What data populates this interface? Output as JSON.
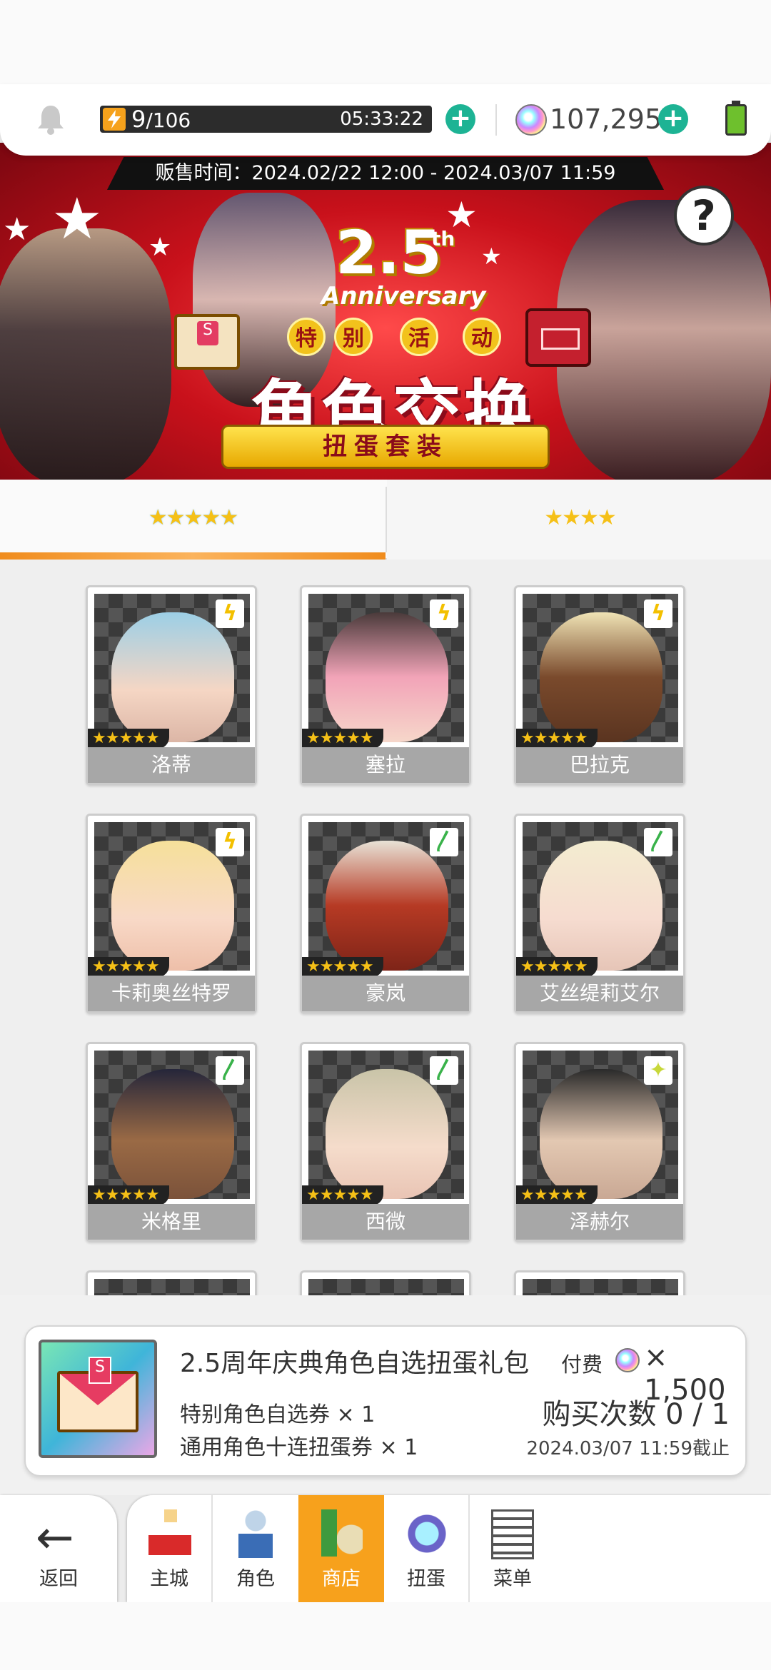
{
  "header": {
    "stamina_current": "9",
    "stamina_max": "/106",
    "stamina_timer": "05:33:22",
    "gem_count": "107,295",
    "plus_symbol": "+"
  },
  "banner": {
    "sale_time": "贩售时间：2024.02/22 12:00 - 2024.03/07 11:59",
    "anniversary_number": "2.5",
    "anniversary_suffix": "th",
    "anniversary_word": "Anniversary",
    "event_chars": [
      "特",
      "别",
      "活",
      "动"
    ],
    "title": "角色交换",
    "subtitle": "扭蛋套装",
    "help_symbol": "?"
  },
  "tabs": [
    {
      "stars": "★★★★★",
      "active": true
    },
    {
      "stars": "★★★★",
      "active": false
    }
  ],
  "characters": [
    {
      "name": "洛蒂",
      "rarity": "★★★★★",
      "element": "light"
    },
    {
      "name": "塞拉",
      "rarity": "★★★★★",
      "element": "light"
    },
    {
      "name": "巴拉克",
      "rarity": "★★★★★",
      "element": "light"
    },
    {
      "name": "卡莉奥丝特罗",
      "rarity": "★★★★★",
      "element": "light"
    },
    {
      "name": "豪岚",
      "rarity": "★★★★★",
      "element": "wind"
    },
    {
      "name": "艾丝缇莉艾尔",
      "rarity": "★★★★★",
      "element": "wind"
    },
    {
      "name": "米格里",
      "rarity": "★★★★★",
      "element": "wind"
    },
    {
      "name": "西微",
      "rarity": "★★★★★",
      "element": "wind"
    },
    {
      "name": "泽赫尔",
      "rarity": "★★★★★",
      "element": "star"
    }
  ],
  "element_symbols": {
    "light": "ϟ",
    "wind": "〳",
    "star": "✦"
  },
  "offer": {
    "title": "2.5周年庆典角色自选扭蛋礼包",
    "pay_label": "付费",
    "price": "× 1,500",
    "line1": "特别角色自选券 × 1",
    "line2": "通用角色十连扭蛋券 × 1",
    "purchase_count": "购买次数 0 / 1",
    "deadline": "2024.03/07 11:59截止"
  },
  "nav": {
    "back": "返回",
    "items": [
      {
        "label": "主城",
        "icon": "city-icon",
        "active": false
      },
      {
        "label": "角色",
        "icon": "character-icon",
        "active": false
      },
      {
        "label": "商店",
        "icon": "shop-icon",
        "active": true
      },
      {
        "label": "扭蛋",
        "icon": "gacha-icon",
        "active": false
      },
      {
        "label": "菜单",
        "icon": "menu-icon",
        "active": false
      }
    ]
  },
  "colors": {
    "accent": "#f7a11c",
    "plus_button": "#1db394",
    "banner_red": "#c9111b",
    "card_name_bg": "#a7a7a7"
  }
}
